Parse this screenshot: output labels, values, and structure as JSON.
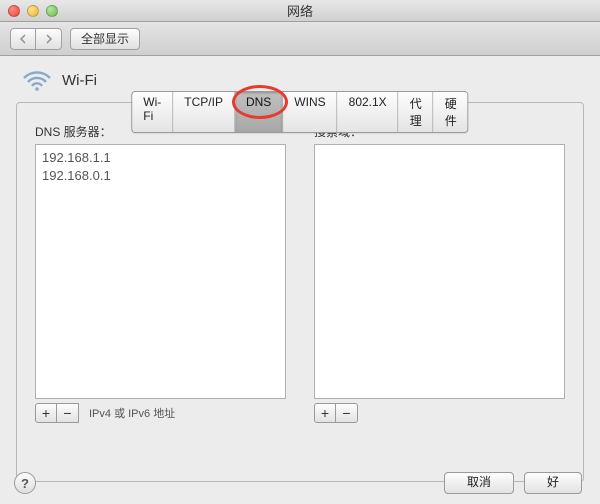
{
  "window": {
    "title": "网络"
  },
  "toolbar": {
    "show_all": "全部显示"
  },
  "connection": {
    "name": "Wi-Fi"
  },
  "tabs": [
    {
      "label": "Wi-Fi"
    },
    {
      "label": "TCP/IP"
    },
    {
      "label": "DNS",
      "active": true
    },
    {
      "label": "WINS"
    },
    {
      "label": "802.1X"
    },
    {
      "label": "代理"
    },
    {
      "label": "硬件"
    }
  ],
  "dns": {
    "label": "DNS 服务器：",
    "servers": [
      "192.168.1.1",
      "192.168.0.1"
    ],
    "hint": "IPv4 或 IPv6 地址"
  },
  "search_domains": {
    "label": "搜索域：",
    "items": []
  },
  "buttons": {
    "add": "+",
    "remove": "−",
    "help": "?",
    "cancel": "取消",
    "ok": "好"
  },
  "highlight": {
    "tab_index": 2
  }
}
